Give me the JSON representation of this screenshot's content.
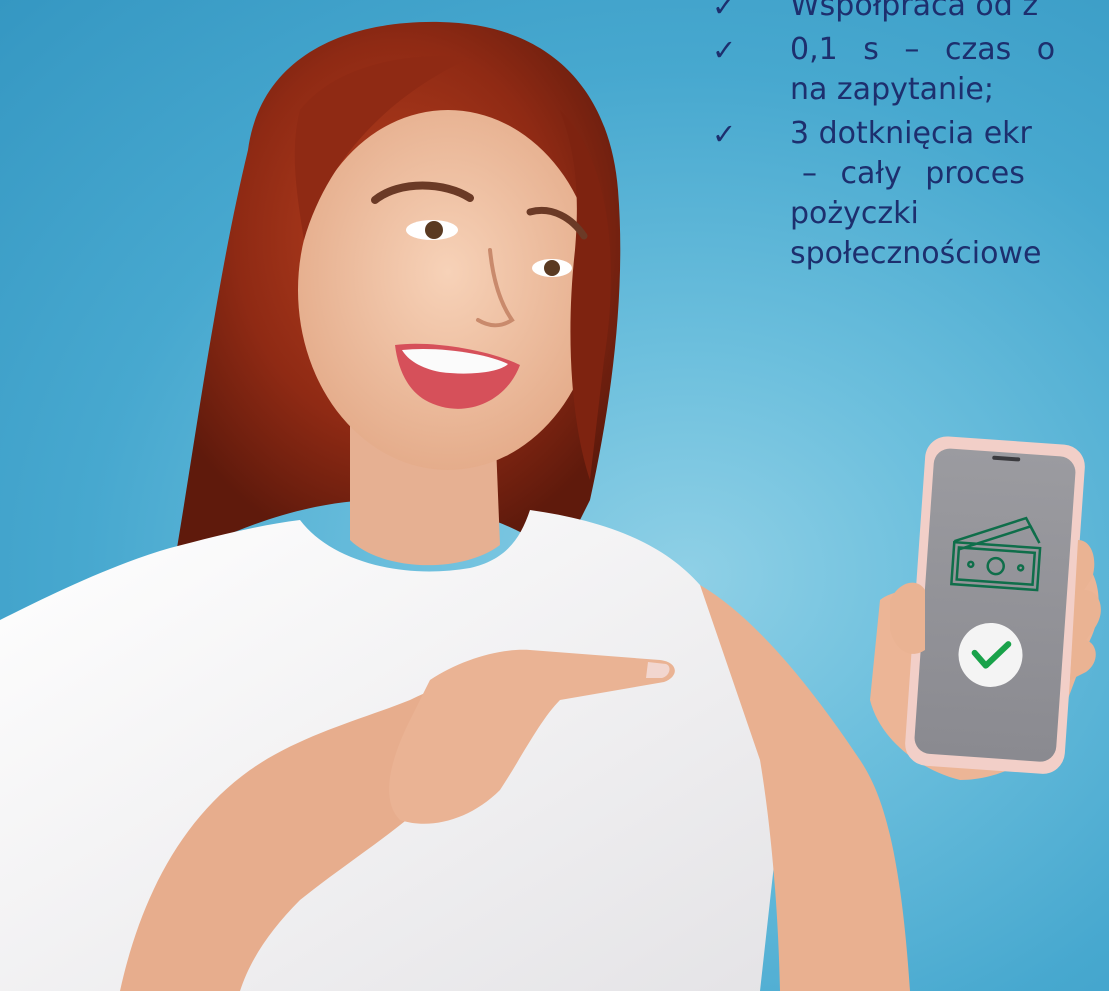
{
  "benefits": [
    {
      "icon": "checkmark-icon",
      "check": "✓",
      "lines": [
        "Współpraca od z"
      ]
    },
    {
      "icon": "checkmark-icon",
      "check": "✓",
      "lines": [
        "0,1 s – czas o",
        "na zapytanie;"
      ]
    },
    {
      "icon": "checkmark-icon",
      "check": "✓",
      "lines": [
        "3 dotknięcia ekr",
        "– cały proces",
        "pożyczki",
        "społecznościowe"
      ]
    }
  ],
  "phone_screen": {
    "icons": [
      "banknote-stack-icon",
      "success-check-icon"
    ],
    "colors": {
      "screen": "#8f8f94",
      "frame": "#f2cfc8",
      "icon_green": "#0f6e4a",
      "check_green": "#19a24a"
    }
  },
  "palette": {
    "background": "#4aaed3",
    "text": "#1d2f6e",
    "shirt": "#f3f1f1",
    "hair": "#9a2d16",
    "skin": "#f0c1a2"
  }
}
